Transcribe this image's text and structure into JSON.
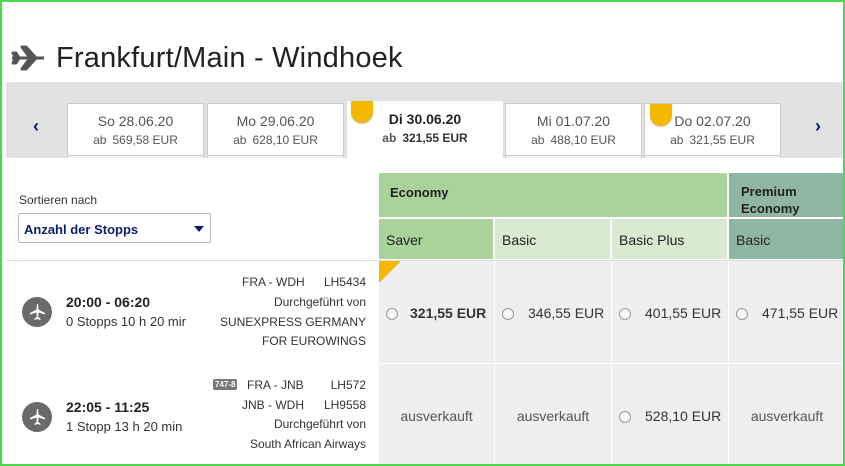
{
  "header": {
    "title": "Frankfurt/Main - Windhoek",
    "icon": "airplane-icon"
  },
  "carousel": {
    "prev": "‹",
    "next": "›",
    "dates": [
      {
        "label": "So 28.06.20",
        "ab": "ab",
        "price": "569,58 EUR",
        "active": false,
        "badge": false
      },
      {
        "label": "Mo 29.06.20",
        "ab": "ab",
        "price": "628,10 EUR",
        "active": false,
        "badge": false
      },
      {
        "label": "Di 30.06.20",
        "ab": "ab",
        "price": "321,55 EUR",
        "active": true,
        "badge": true
      },
      {
        "label": "Mi 01.07.20",
        "ab": "ab",
        "price": "488,10 EUR",
        "active": false,
        "badge": false
      },
      {
        "label": "Do 02.07.20",
        "ab": "ab",
        "price": "321,55 EUR",
        "active": false,
        "badge": true
      }
    ]
  },
  "sort": {
    "label": "Sortieren nach",
    "selected": "Anzahl der Stopps"
  },
  "cabins": {
    "economy": "Economy",
    "premium": "Premium Economy",
    "fares": [
      "Saver",
      "Basic",
      "Basic Plus",
      "Basic"
    ]
  },
  "flights": [
    {
      "times": "20:00 - 06:20",
      "stops": "0 Stopps 10 h 20 min",
      "segments": [
        {
          "route": "FRA - WDH",
          "flight": "LH5434"
        }
      ],
      "operated_label": "Durchgeführt von",
      "operator": "SUNEXPRESS GERMANY FOR EUROWINGS",
      "operator_line1": "SUNEXPRESS GERMANY",
      "operator_line2": "FOR EUROWINGS",
      "prices": [
        "321,55 EUR",
        "346,55 EUR",
        "401,55 EUR",
        "471,55 EUR"
      ]
    },
    {
      "times": "22:05 - 11:25",
      "stops": "1 Stopp 13 h 20 min",
      "aircraft": "747-8",
      "segments": [
        {
          "route": "FRA - JNB",
          "flight": "LH572"
        },
        {
          "route": "JNB - WDH",
          "flight": "LH9558"
        }
      ],
      "operated_label": "Durchgeführt von",
      "operator": "South African Airways",
      "prices": [
        "ausverkauft",
        "ausverkauft",
        "528,10 EUR",
        "ausverkauft"
      ]
    }
  ],
  "colors": {
    "economy": "#a9d39b",
    "economy_light": "#d8ebd0",
    "premium": "#8fb6a5",
    "badge": "#f5b800",
    "link": "#0a1e6e"
  }
}
